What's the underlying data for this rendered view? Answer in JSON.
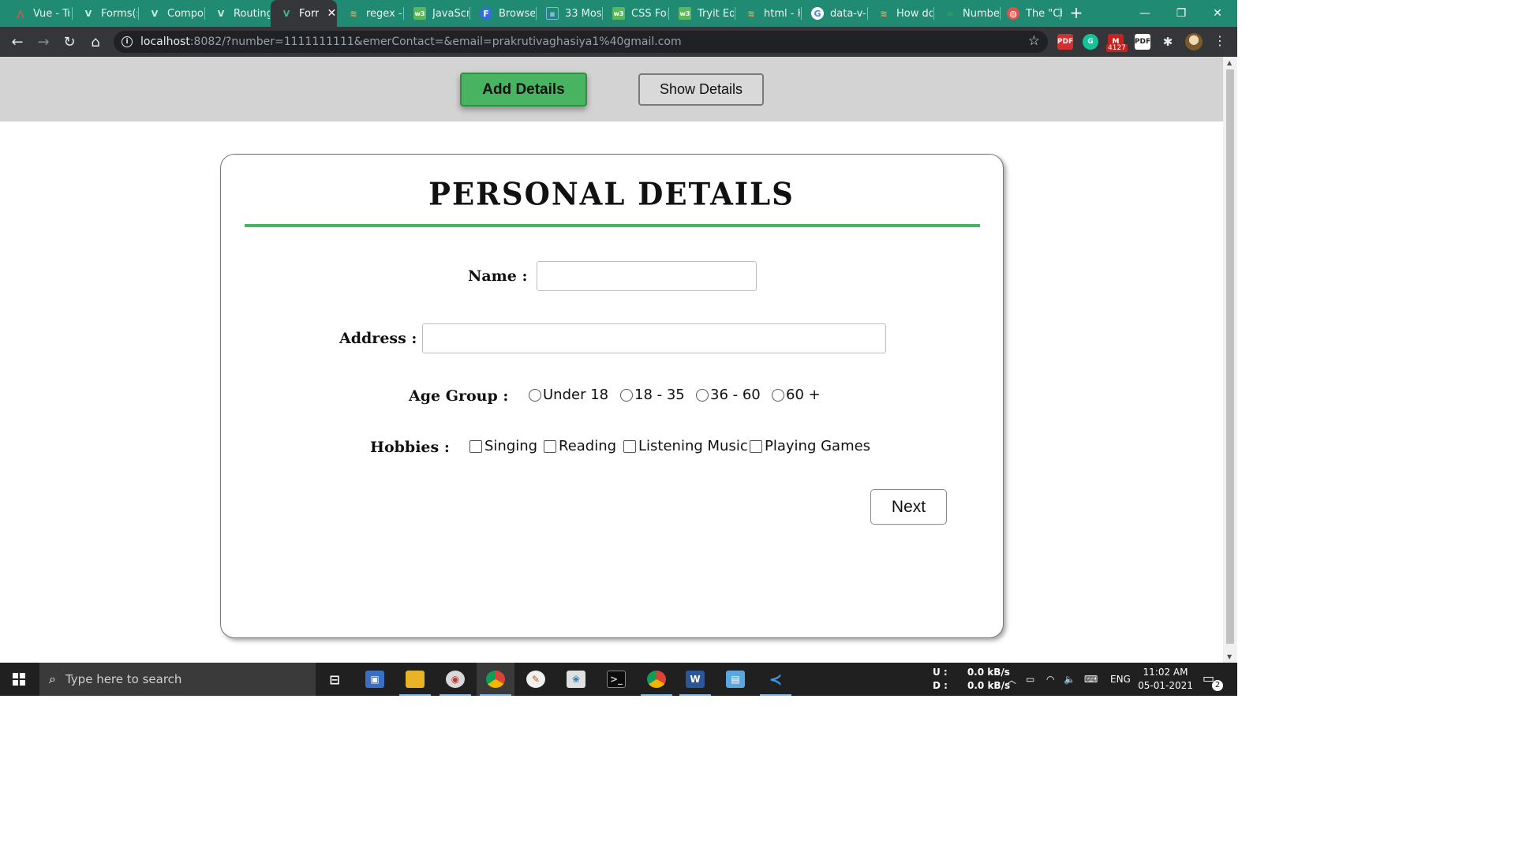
{
  "browser": {
    "tabs": [
      {
        "title": "Vue - Tr",
        "icon": "vue-logo-red",
        "active": false
      },
      {
        "title": "Forms(s",
        "icon": "vue-logo",
        "active": false
      },
      {
        "title": "Compo",
        "icon": "vue-logo",
        "active": false
      },
      {
        "title": "Routing",
        "icon": "vue-logo",
        "active": false
      },
      {
        "title": "Forr",
        "icon": "vue-logo",
        "active": true
      },
      {
        "title": "regex -",
        "icon": "stackoverflow",
        "active": false
      },
      {
        "title": "JavaScr",
        "icon": "w3schools",
        "active": false
      },
      {
        "title": "Browse",
        "icon": "f-logo",
        "active": false
      },
      {
        "title": "33 Mos",
        "icon": "square-logo",
        "active": false
      },
      {
        "title": "CSS For",
        "icon": "w3schools",
        "active": false
      },
      {
        "title": "Tryit Ed",
        "icon": "w3schools",
        "active": false
      },
      {
        "title": "html - H",
        "icon": "stackoverflow",
        "active": false
      },
      {
        "title": "data-v-",
        "icon": "google",
        "active": false
      },
      {
        "title": "How do",
        "icon": "stackoverflow",
        "active": false
      },
      {
        "title": "Numbe",
        "icon": "link-logo",
        "active": false
      },
      {
        "title": "The \"Ch",
        "icon": "globe-logo",
        "active": false
      }
    ],
    "tab_close_glyph": "✕",
    "new_tab_glyph": "+",
    "window_controls": {
      "minimize": "—",
      "restore": "❐",
      "close": "✕"
    },
    "url_host": "localhost",
    "url_rest": ":8082/?number=1111111111&emerContact=&email=prakrutivaghasiya1%40gmail.com",
    "extension_badge": "4127"
  },
  "nav": {
    "add_details": "Add Details",
    "show_details": "Show Details"
  },
  "form": {
    "title": "PERSONAL DETAILS",
    "name_label": "Name :",
    "name_value": "",
    "address_label": "Address :",
    "address_value": "",
    "age_label": "Age Group :",
    "age_options": [
      "Under 18",
      "18 - 35",
      "36 - 60",
      "60 +"
    ],
    "hobbies_label": "Hobbies :",
    "hobby_options": [
      "Singing",
      "Reading",
      "Listening Music",
      "Playing Games"
    ],
    "next_label": "Next"
  },
  "taskbar": {
    "search_placeholder": "Type here to search",
    "net_up_label": "U :",
    "net_up_value": "0.0 kB/s",
    "net_down_label": "D :",
    "net_down_value": "0.0 kB/s",
    "language": "ENG",
    "time": "11:02 AM",
    "date": "05-01-2021",
    "notification_count": "2"
  },
  "colors": {
    "tab_strip": "#208a73",
    "accent_green": "#48b360",
    "page_nav_bg": "#d3d3d3"
  }
}
